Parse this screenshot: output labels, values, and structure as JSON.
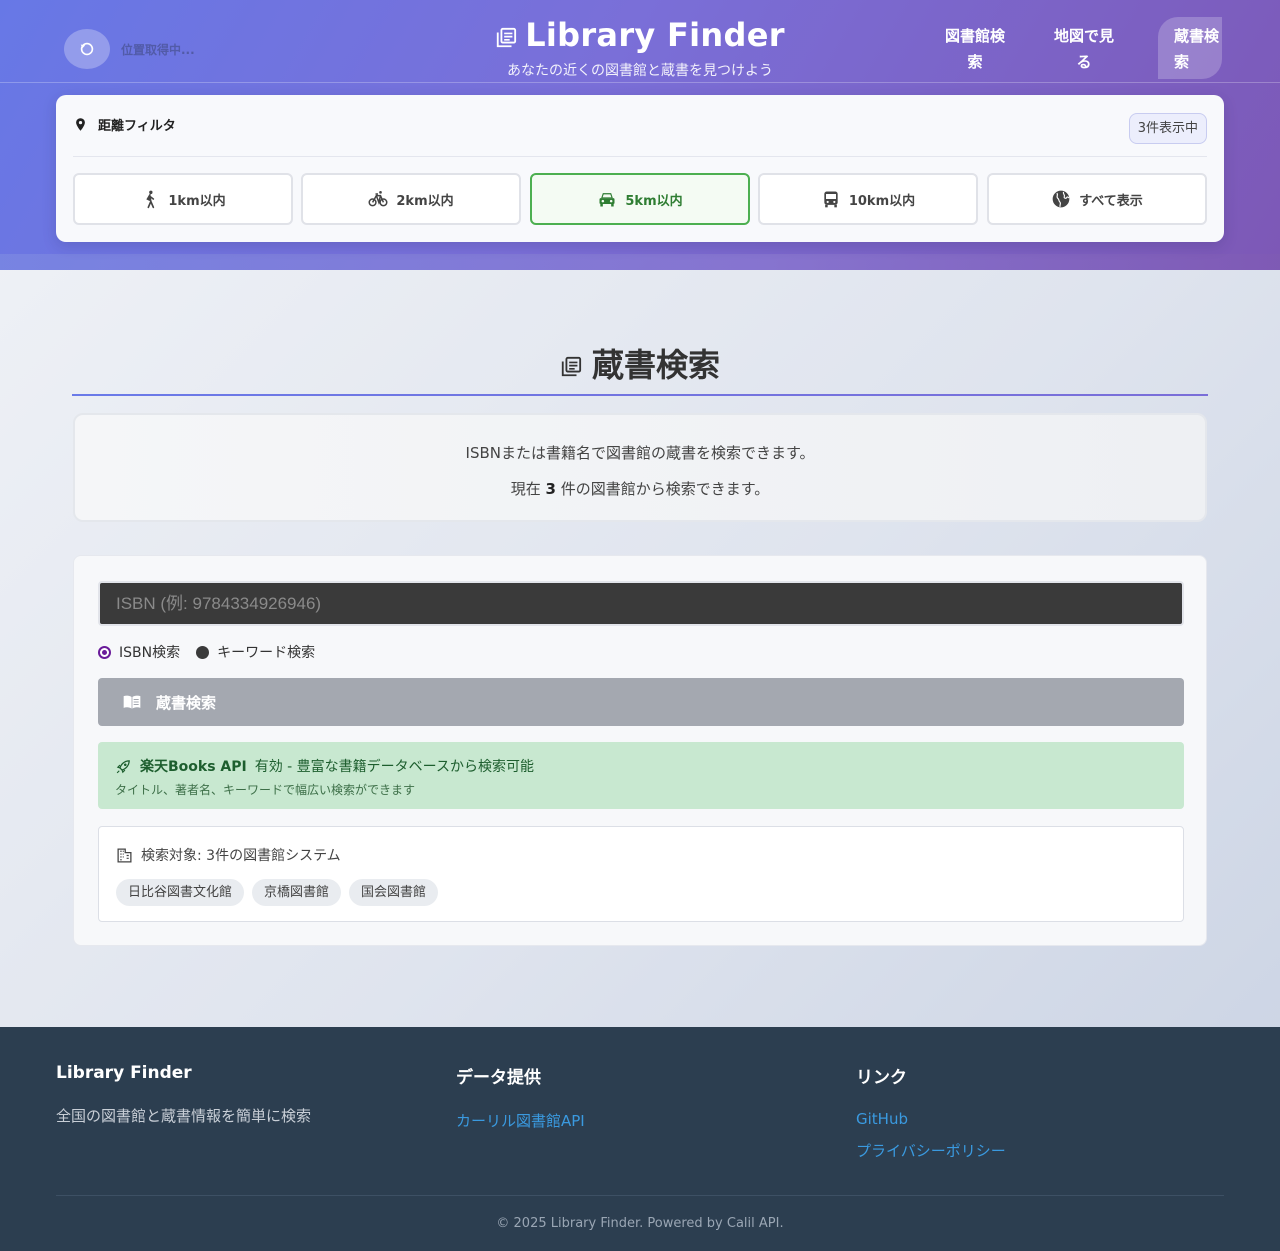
{
  "header": {
    "location_status": "位置取得中...",
    "title": "Library Finder",
    "subtitle": "あなたの近くの図書館と蔵書を見つけよう",
    "nav": [
      {
        "label": "図書館検索"
      },
      {
        "label": "地図で見る"
      },
      {
        "label": "蔵書検索"
      }
    ],
    "colors": {
      "gradient_start": "#6778e6",
      "gradient_end": "#7d58b6"
    }
  },
  "filter": {
    "title": "距離フィルタ",
    "count_badge": "3件表示中",
    "options": [
      {
        "label": "1km以内",
        "icon": "walk-icon",
        "active": false
      },
      {
        "label": "2km以内",
        "icon": "bicycle-icon",
        "active": false
      },
      {
        "label": "5km以内",
        "icon": "car-icon",
        "active": true
      },
      {
        "label": "10km以内",
        "icon": "bus-icon",
        "active": false
      },
      {
        "label": "すべて表示",
        "icon": "globe-icon",
        "active": false
      }
    ],
    "active_color": "#4caf50"
  },
  "main": {
    "section_title": "蔵書検索",
    "info_line1": "ISBNまたは書籍名で図書館の蔵書を検索できます。",
    "info_line2_prefix": "現在",
    "info_line2_count": "3",
    "info_line2_suffix": "件の図書館から検索できます。",
    "search": {
      "placeholder": "ISBN (例: 9784334926946)",
      "value": "",
      "mode_options": [
        {
          "label": "ISBN検索",
          "selected": true
        },
        {
          "label": "キーワード検索",
          "selected": false
        }
      ],
      "button_label": "蔵書検索"
    },
    "api_notice": {
      "strong": "楽天Books API",
      "text": "有効 - 豊富な書籍データベースから検索可能",
      "sub": "タイトル、著者名、キーワードで幅広い検索ができます"
    },
    "targets": {
      "heading": "検索対象: 3件の図書館システム",
      "libraries": [
        "日比谷図書文化館",
        "京橋図書館",
        "国会図書館"
      ]
    }
  },
  "footer": {
    "col1": {
      "title": "Library Finder",
      "text": "全国の図書館と蔵書情報を簡単に検索"
    },
    "col2": {
      "title": "データ提供",
      "links": [
        "カーリル図書館API"
      ]
    },
    "col3": {
      "title": "リンク",
      "links": [
        "GitHub",
        "プライバシーポリシー"
      ]
    },
    "copyright": "© 2025 Library Finder. Powered by Calil API.",
    "background": "#2c3e50",
    "link_color": "#3a9ae0"
  }
}
